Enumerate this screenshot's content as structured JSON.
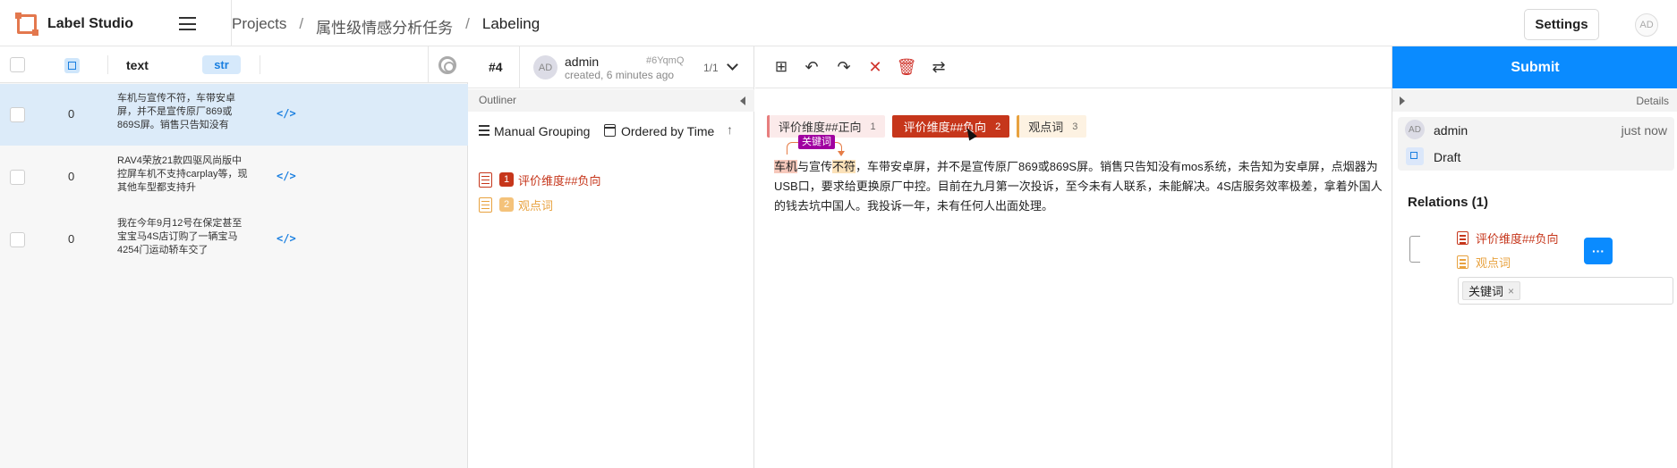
{
  "app": {
    "name": "Label Studio"
  },
  "breadcrumb": [
    "Projects",
    "属性级情感分析任务",
    "Labeling"
  ],
  "header": {
    "settings_label": "Settings",
    "user_initials": "AD"
  },
  "table": {
    "columns": {
      "text": "text",
      "type_badge": "str"
    },
    "rows": [
      {
        "id": "0",
        "text": "车机与宣传不符，车带安卓屏，并不是宣传原厂869或869S屏。销售只告知没有",
        "code": "</>"
      },
      {
        "id": "0",
        "text": "RAV4荣放21款四驱风尚版中控屏车机不支持carplay等，现其他车型都支持升",
        "code": "</>"
      },
      {
        "id": "0",
        "text": "我在今年9月12号在保定甚至宝宝马4S店订购了一辆宝马4254门运动轿车交了",
        "code": "</>"
      }
    ]
  },
  "annotation": {
    "task_id": "#4",
    "user_initials": "AD",
    "user": "admin",
    "created": "created, 6 minutes ago",
    "hash": "#6YqmQ",
    "count": "1/1"
  },
  "outliner": {
    "title": "Outliner",
    "grouping": "Manual Grouping",
    "ordering": "Ordered by Time",
    "regions": [
      {
        "index": "1",
        "label": "评价维度##负向",
        "color": "#c6361b"
      },
      {
        "index": "2",
        "label": "观点词",
        "color": "#e8a23f"
      }
    ]
  },
  "labels": [
    {
      "text": "评价维度##正向",
      "hotkey": "1",
      "color": "#e77e7e",
      "selected": false
    },
    {
      "text": "评价维度##负向",
      "hotkey": "2",
      "color": "#c6361b",
      "selected": true
    },
    {
      "text": "观点词",
      "hotkey": "3",
      "color": "#e8a23f",
      "selected": false
    }
  ],
  "document": {
    "span_negative": "车机",
    "mid1": "与宣传",
    "span_view": "不符",
    "rest": "，车带安卓屏，并不是宣传原厂869或869S屏。销售只告知没有mos系统，未告知为安卓屏，点烟器为USB口，要求给更换原厂中控。目前在九月第一次投诉，至今未有人联系，未能解决。4S店服务效率极差，拿着外国人的钱去坑中国人。我投诉一年，未有任何人出面处理。",
    "relation_tag": "关键词"
  },
  "right_panel": {
    "submit_label": "Submit",
    "details_label": "Details",
    "user_initials": "AD",
    "user": "admin",
    "time": "just now",
    "status": "Draft",
    "relations_title": "Relations (1)",
    "relation_from": "评价维度##负向",
    "relation_to": "观点词",
    "relation_more": "···",
    "relation_label": "关键词",
    "relation_label_remove": "×"
  }
}
